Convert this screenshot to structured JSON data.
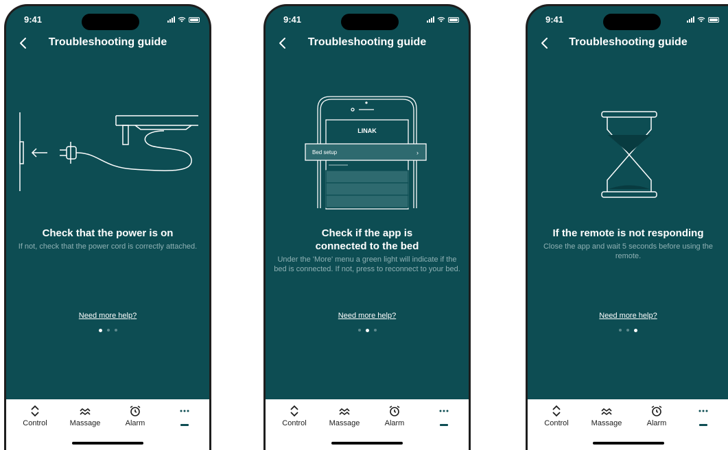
{
  "status": {
    "time": "9:41"
  },
  "nav": {
    "title": "Troubleshooting guide"
  },
  "screens": [
    {
      "headline": "Check that the power is on",
      "description": "If not, check that the power cord is correctly attached.",
      "help_link": "Need more help?",
      "page_index": 0
    },
    {
      "headline": "Check if the app is connected to the bed",
      "description": "Under the 'More' menu a green light will indicate if the bed is connected. If not, press to reconnect to your bed.",
      "help_link": "Need more help?",
      "page_index": 1,
      "mockup": {
        "logo": "LINAK",
        "menu_item": "Bed setup",
        "chevron": "›"
      }
    },
    {
      "headline": "If the remote is not responding",
      "description": "Close the app and wait 5 seconds before using the remote.",
      "help_link": "Need more help?",
      "page_index": 2
    }
  ],
  "pagination": {
    "total": 3
  },
  "tabs": [
    {
      "label": "Control",
      "icon": "up-down-chevron-icon"
    },
    {
      "label": "Massage",
      "icon": "waves-icon"
    },
    {
      "label": "Alarm",
      "icon": "alarm-clock-icon"
    },
    {
      "label": "",
      "icon": "more-dots-icon",
      "selected": true
    }
  ],
  "colors": {
    "background": "#0d4d53",
    "text": "#ffffff",
    "muted_text": "#8fb1b4",
    "tabbar": "#ffffff"
  }
}
